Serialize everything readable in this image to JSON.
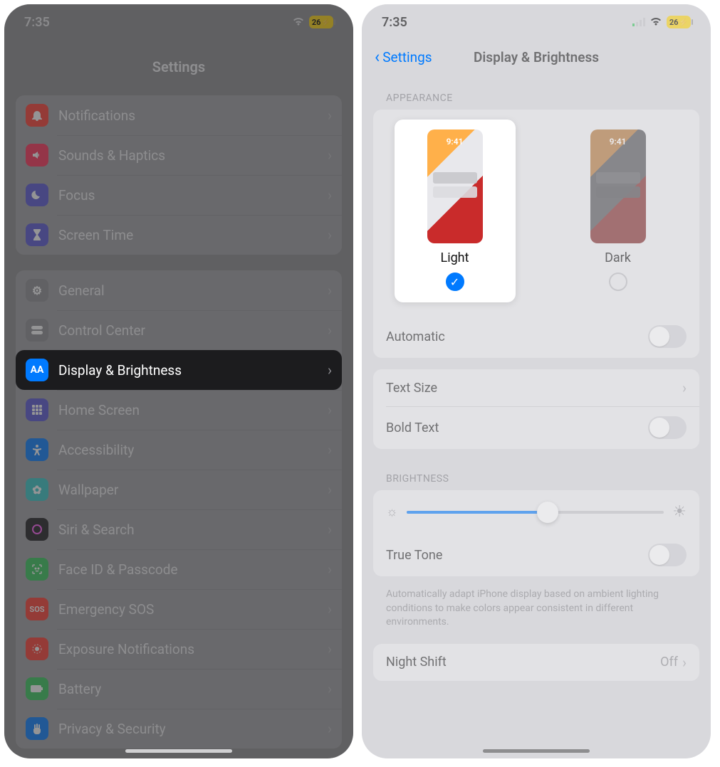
{
  "status": {
    "time": "7:35",
    "battery": "26"
  },
  "left": {
    "title": "Settings",
    "group1": [
      {
        "label": "Notifications"
      },
      {
        "label": "Sounds & Haptics"
      },
      {
        "label": "Focus"
      },
      {
        "label": "Screen Time"
      }
    ],
    "group2": [
      {
        "label": "General"
      },
      {
        "label": "Control Center"
      },
      {
        "label": "Display & Brightness",
        "selected": true
      },
      {
        "label": "Home Screen"
      },
      {
        "label": "Accessibility"
      },
      {
        "label": "Wallpaper"
      },
      {
        "label": "Siri & Search"
      },
      {
        "label": "Face ID & Passcode"
      },
      {
        "label": "Emergency SOS"
      },
      {
        "label": "Exposure Notifications"
      },
      {
        "label": "Battery"
      },
      {
        "label": "Privacy & Security"
      }
    ]
  },
  "right": {
    "back_label": "Settings",
    "title": "Display & Brightness",
    "appearance_header": "APPEARANCE",
    "thumb_time": "9:41",
    "light_label": "Light",
    "dark_label": "Dark",
    "automatic_label": "Automatic",
    "text_size_label": "Text Size",
    "bold_text_label": "Bold Text",
    "brightness_header": "BRIGHTNESS",
    "brightness_percent": 55,
    "true_tone_label": "True Tone",
    "true_tone_note": "Automatically adapt iPhone display based on ambient lighting conditions to make colors appear consistent in different environments.",
    "night_shift_label": "Night Shift",
    "night_shift_value": "Off"
  }
}
